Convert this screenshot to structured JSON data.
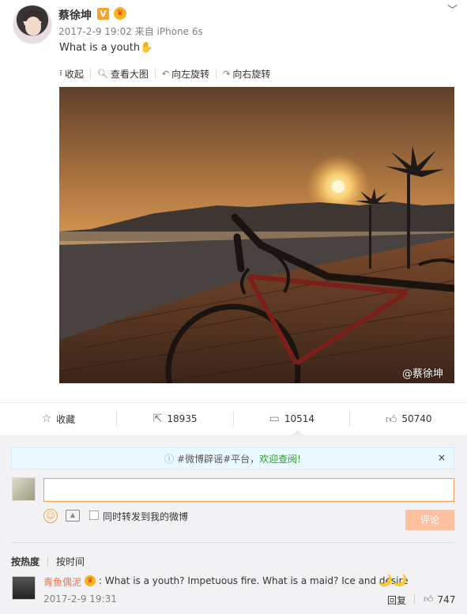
{
  "post": {
    "author": "蔡徐坤",
    "verified_badge": "V",
    "timestamp": "2017-2-9 19:02",
    "source_prefix": "来自",
    "device": "iPhone 6s",
    "text": "What is a youth",
    "text_emoji": "wave-hand-icon"
  },
  "image_toolbar": {
    "collapse": "收起",
    "view_large": "查看大图",
    "rotate_left": "向左旋转",
    "rotate_right": "向右旋转"
  },
  "photo": {
    "watermark": "@蔡徐坤"
  },
  "actions": {
    "favorite": "收藏",
    "reposts": "18935",
    "comments": "10514",
    "likes": "50740"
  },
  "notice": {
    "tag": "#微博辟谣#平台",
    "separator": "，",
    "link": "欢迎查阅!",
    "close": "×"
  },
  "composer": {
    "input_value": "",
    "also_repost": "同时转发到我的微博",
    "submit": "评论"
  },
  "sort": {
    "hot": "按热度",
    "time": "按时间"
  },
  "comments": [
    {
      "author": "青鱼偶泥",
      "text": ": What is a youth? Impetuous fire. What is a maid? Ice and desire",
      "moons": "🌙🌙",
      "time": "2017-2-9 19:31",
      "reply": "回复",
      "likes": "747"
    }
  ],
  "colors": {
    "accent_orange": "#eb7350",
    "input_border": "#f29d5b",
    "submit_bg": "#ffc09f",
    "notice_bg": "#eaf8ff"
  }
}
